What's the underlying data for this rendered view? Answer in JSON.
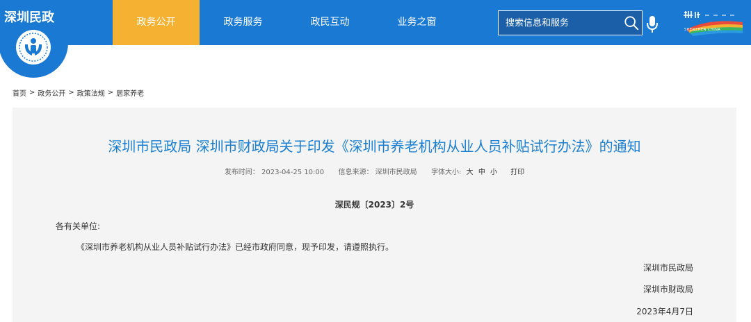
{
  "header": {
    "logo_text": "深圳民政",
    "nav": [
      {
        "label": "政务公开",
        "active": true
      },
      {
        "label": "政务服务",
        "active": false
      },
      {
        "label": "政民互动",
        "active": false
      },
      {
        "label": "业务之窗",
        "active": false
      }
    ],
    "search_placeholder": "搜索信息和服务",
    "brand_text": "SHENZHEN CHINA"
  },
  "breadcrumb": [
    "首页",
    "政务公开",
    "政策法规",
    "居家养老"
  ],
  "breadcrumb_sep": ">",
  "article": {
    "title": "深圳市民政局 深圳市财政局关于印发《深圳市养老机构从业人员补贴试行办法》的通知",
    "publish_label": "发布时间：",
    "publish_time": "2023-04-25 10:00",
    "source_label": "信息来源：",
    "source": "深圳市民政局",
    "font_size_label": "字体大小:",
    "font_large": "大",
    "font_medium": "中",
    "font_small": "小",
    "print_label": "打印",
    "doc_number": "深民规〔2023〕2号",
    "salutation": "各有关单位:",
    "body": "《深圳市养老机构从业人员补贴试行办法》已经市政府同意，现予印发，请遵照执行。",
    "signatory_1": "深圳市民政局",
    "signatory_2": "深圳市财政局",
    "date": "2023年4月7日"
  },
  "colors": {
    "header_blue": "#1a79d2",
    "nav_active": "#f5b232",
    "title_blue": "#1a7fd1",
    "content_bg": "#f4f4f4"
  }
}
